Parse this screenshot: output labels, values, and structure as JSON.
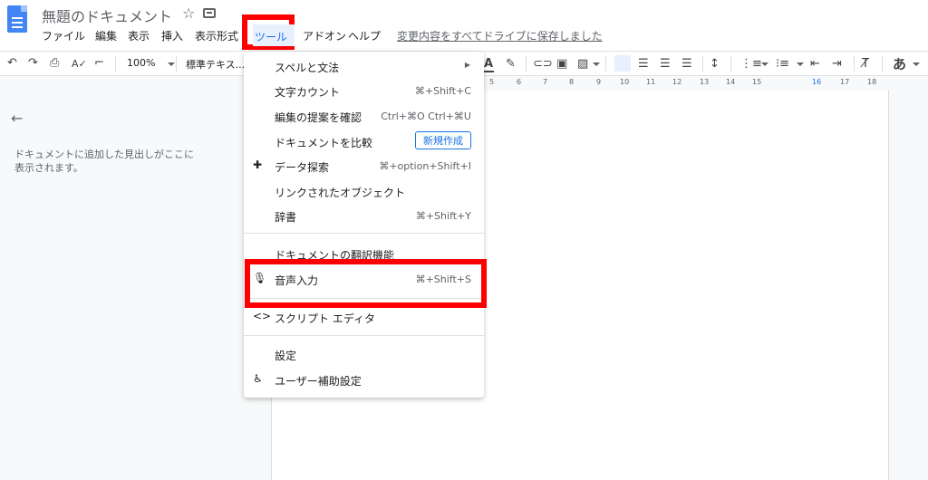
{
  "app": {
    "doc_title": "無題のドキュメント",
    "saved_status": "変更内容をすべてドライブに保存しました"
  },
  "menubar": {
    "items": [
      "ファイル",
      "編集",
      "表示",
      "挿入",
      "表示形式",
      "ツール",
      "アドオン",
      "ヘルプ"
    ]
  },
  "toolbar": {
    "zoom": "100%",
    "paragraph_style": "標準テキス..."
  },
  "ruler": {
    "ticks": [
      "5",
      "6",
      "7",
      "8",
      "9",
      "10",
      "11",
      "12",
      "13",
      "14",
      "15",
      "16",
      "17",
      "18"
    ]
  },
  "outline": {
    "hint": "ドキュメントに追加した見出しがここに表示されます。"
  },
  "tools_menu": {
    "items": [
      {
        "label": "スペルと文法"
      },
      {
        "label": "文字カウント",
        "shortcut": "⌘+Shift+C"
      },
      {
        "label": "編集の提案を確認",
        "shortcut": "Ctrl+⌘O Ctrl+⌘U"
      },
      {
        "label": "ドキュメントを比較",
        "badge": "新規作成"
      },
      {
        "label": "データ探索",
        "shortcut": "⌘+option+Shift+I"
      },
      {
        "label": "リンクされたオブジェクト"
      },
      {
        "label": "辞書",
        "shortcut": "⌘+Shift+Y"
      },
      {
        "label": "ドキュメントの翻訳機能"
      },
      {
        "label": "音声入力",
        "shortcut": "⌘+Shift+S"
      },
      {
        "label": "スクリプト エディタ"
      },
      {
        "label": "設定"
      },
      {
        "label": "ユーザー補助設定"
      }
    ]
  },
  "colors": {
    "highlight": "#ff0000",
    "accent": "#1a73e8",
    "docs_blue": "#4285f4"
  }
}
